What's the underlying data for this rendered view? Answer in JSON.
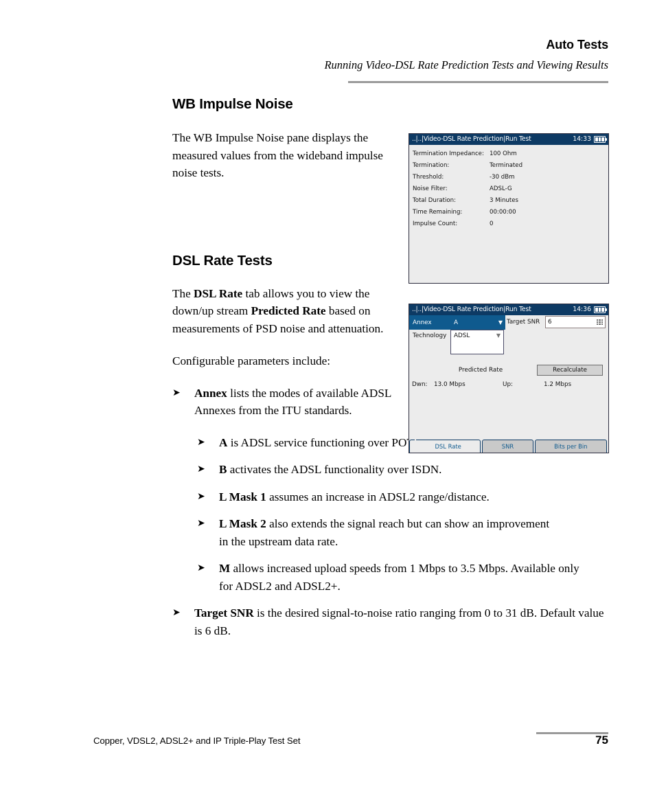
{
  "header": {
    "title": "Auto Tests",
    "subtitle": "Running Video-DSL Rate Prediction Tests and Viewing Results"
  },
  "sections": {
    "wb_impulse": {
      "heading": "WB Impulse Noise",
      "paragraph": "The WB Impulse Noise pane displays the measured values from the wideband impulse noise tests."
    },
    "dsl_rate": {
      "heading": "DSL Rate Tests",
      "paragraph_prefix": "The ",
      "paragraph_b1": "DSL Rate",
      "paragraph_mid": " tab allows you to view the down/up stream ",
      "paragraph_b2": "Predicted Rate",
      "paragraph_suffix": " based on measurements of PSD noise and attenuation.",
      "configurable_line": "Configurable parameters include:"
    }
  },
  "bullets": [
    {
      "level": 1,
      "bold": "Annex",
      "text": " lists the modes of available ADSL Annexes from the ITU standards."
    },
    {
      "level": 2,
      "bold": "A",
      "text": " is ADSL service functioning over POTS."
    },
    {
      "level": 2,
      "bold": "B",
      "text": " activates the ADSL functionality over ISDN."
    },
    {
      "level": 2,
      "bold": "L Mask 1",
      "text": " assumes an increase in ADSL2 range/distance."
    },
    {
      "level": 2,
      "bold": "L Mask 2",
      "text": " also extends the signal reach but can show an improvement in the upstream data rate."
    },
    {
      "level": 2,
      "bold": "M",
      "text": " allows increased upload speeds from 1 Mbps to 3.5 Mbps. Available only for ADSL2 and ADSL2+."
    },
    {
      "level": 1,
      "bold": "Target SNR",
      "text": " is the desired signal-to-noise ratio ranging from 0 to 31 dB. Default value is 6 dB."
    }
  ],
  "bullet_glyph": "➤",
  "device_impulse": {
    "titlebar_left": "..|..|Video-DSL Rate Prediction|Run Test",
    "titlebar_time": "14:33",
    "battery_icon": "battery-icon",
    "rows": [
      {
        "label": "Termination Impedance:",
        "value": "100 Ohm"
      },
      {
        "label": "Termination:",
        "value": "Terminated"
      },
      {
        "label": "Threshold:",
        "value": "-30 dBm"
      },
      {
        "label": "Noise Filter:",
        "value": "ADSL-G"
      },
      {
        "label": "Total Duration:",
        "value": "3 Minutes"
      },
      {
        "label": "Time Remaining:",
        "value": "00:00:00"
      },
      {
        "label": "Impulse Count:",
        "value": "0"
      }
    ]
  },
  "device_dslrate": {
    "titlebar_left": "..|..|Video-DSL Rate Prediction|Run Test",
    "titlebar_time": "14:36",
    "battery_icon": "battery-icon",
    "annex_label": "Annex",
    "annex_value": "A",
    "technology_label": "Technology",
    "technology_value": "ADSL",
    "target_snr_label": "Target SNR",
    "target_snr_value": "6",
    "predicted_rate_label": "Predicted Rate",
    "recalculate_label": "Recalculate",
    "down_label": "Dwn:",
    "down_value": "13.0 Mbps",
    "up_label": "Up:",
    "up_value": "1.2 Mbps",
    "tabs": [
      {
        "label": "DSL Rate",
        "active": true
      },
      {
        "label": "SNR",
        "active": false
      },
      {
        "label": "Bits per Bin",
        "active": false
      }
    ]
  },
  "footer": {
    "text": "Copper, VDSL2, ADSL2+ and IP Triple-Play Test Set",
    "page": "75"
  },
  "colors": {
    "titlebar": "#0d3a64",
    "accent_blue": "#0f5a8e",
    "device_bg": "#ececec",
    "rule_gray": "#9a9a9a"
  }
}
